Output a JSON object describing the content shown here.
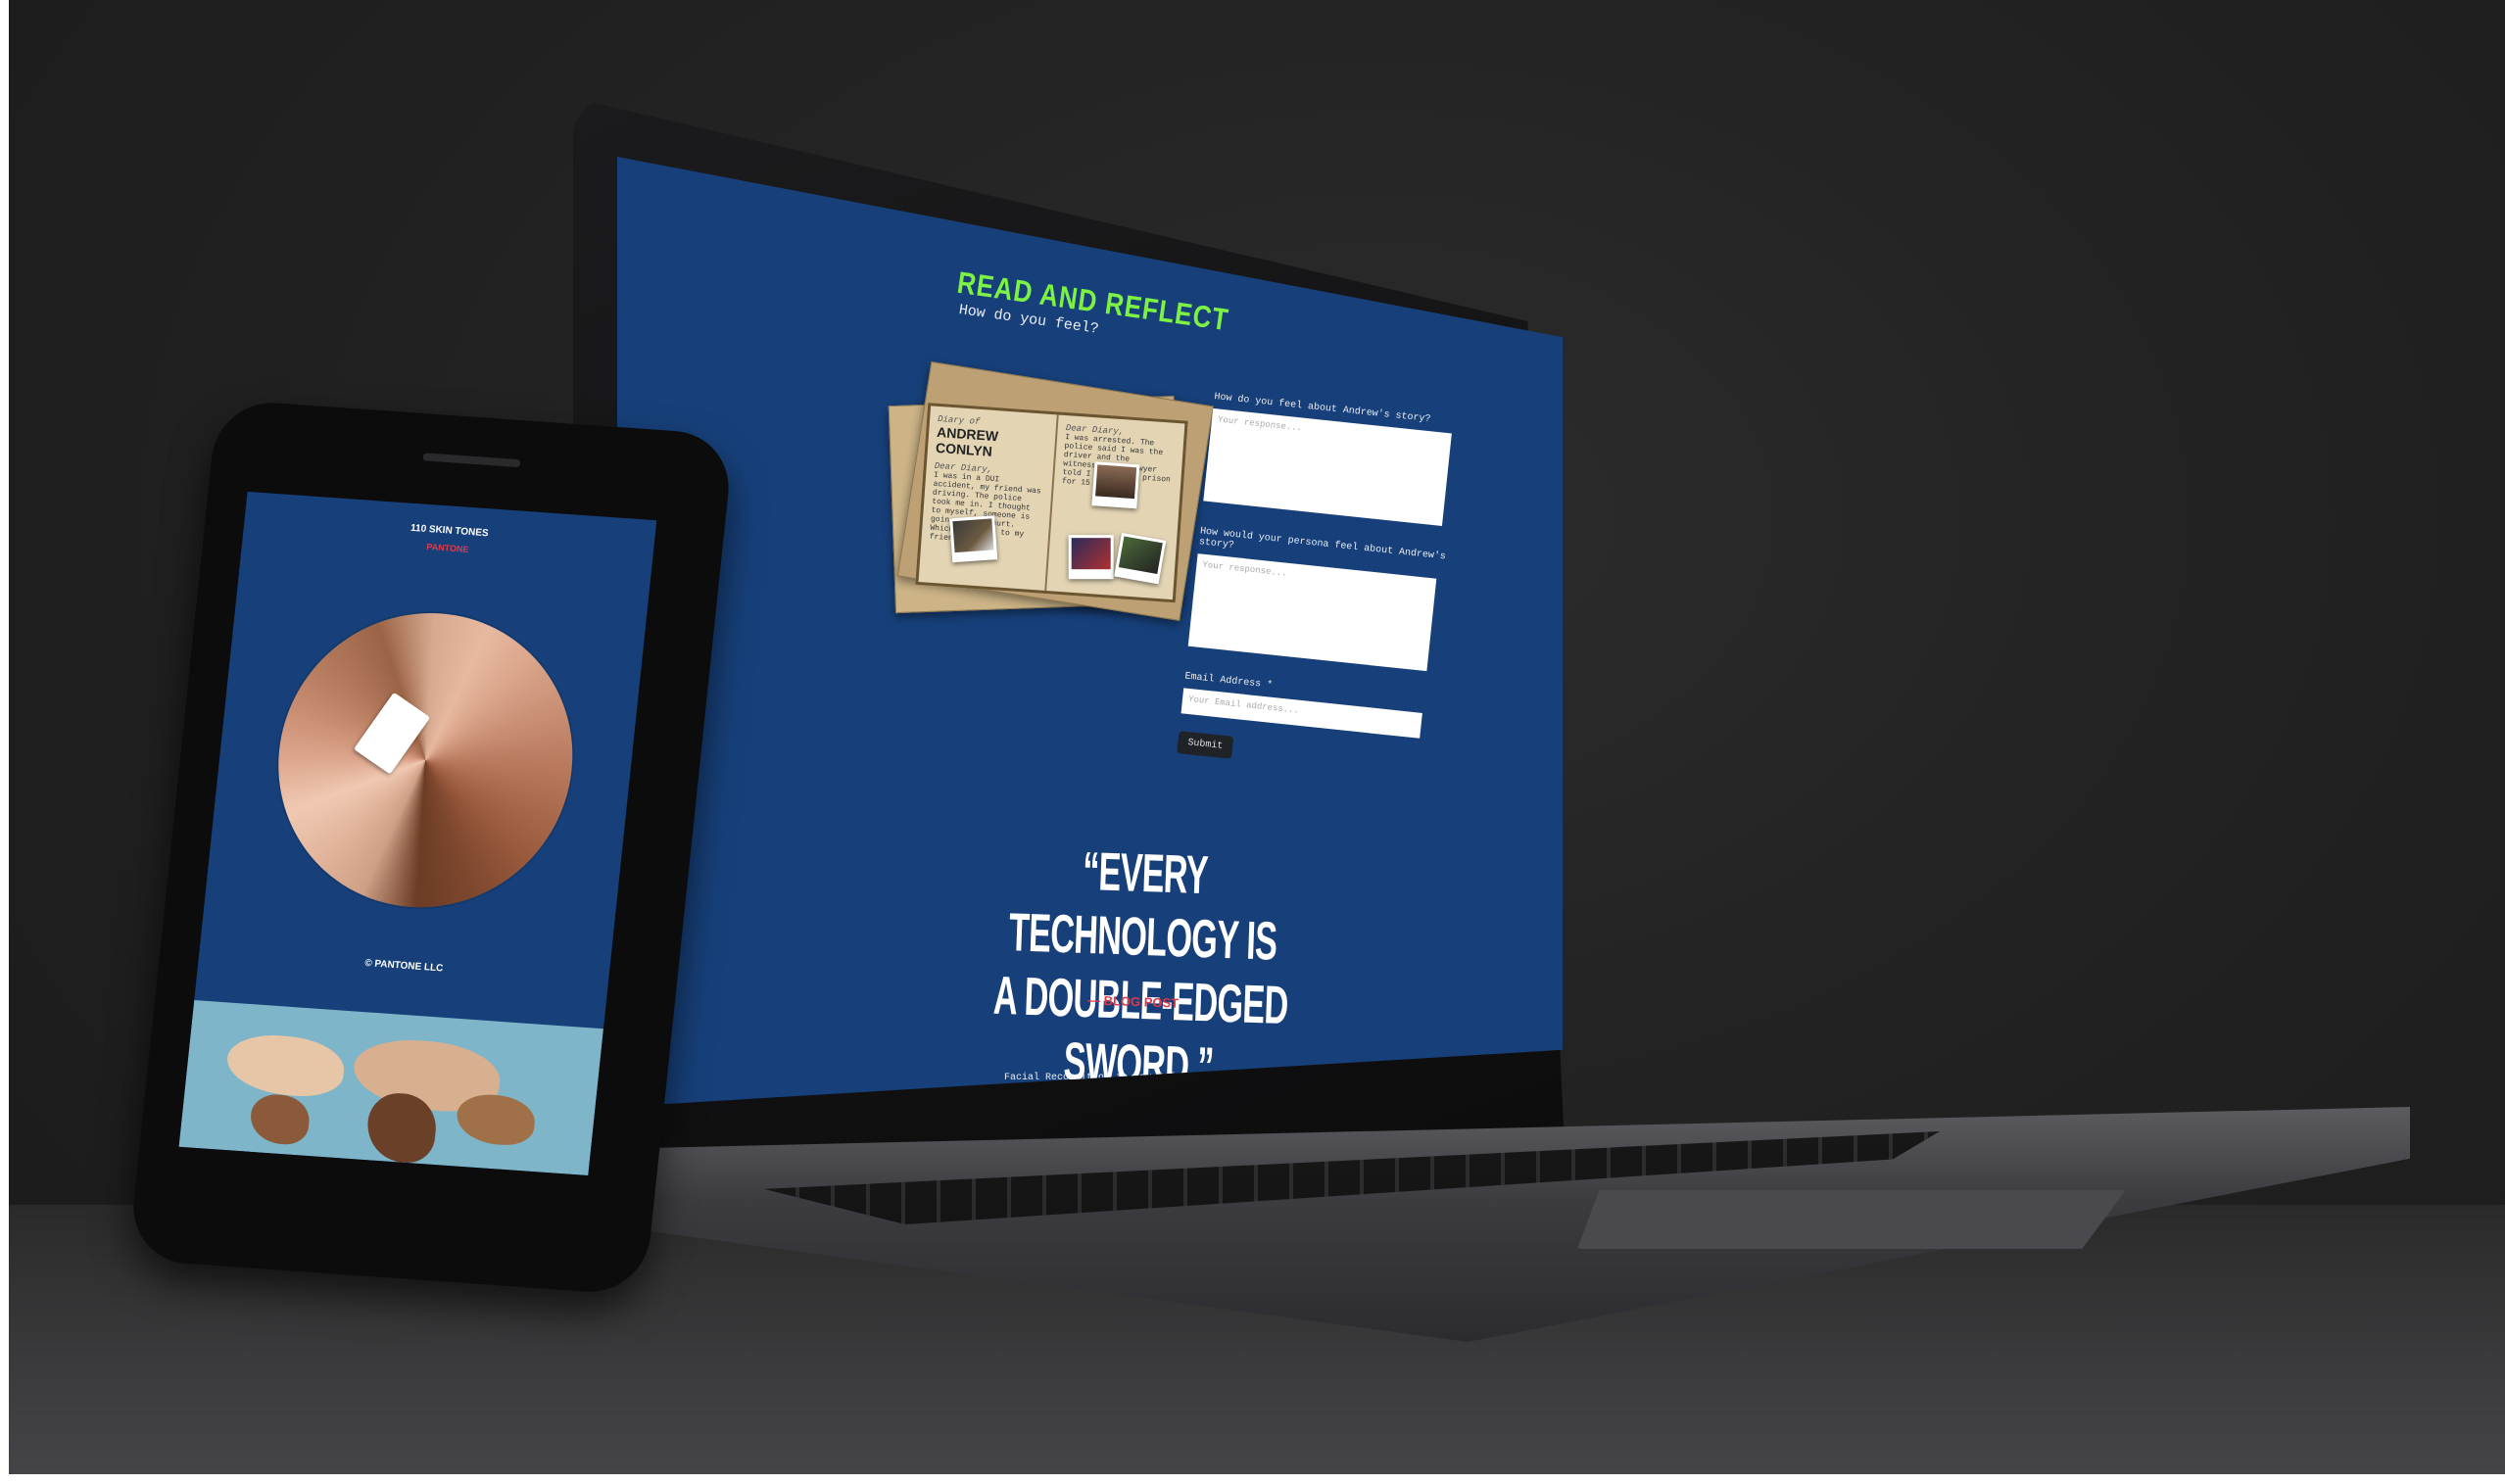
{
  "laptop": {
    "heading": "READ AND REFLECT",
    "subheading": "How do you feel?",
    "diary": {
      "label": "Diary of",
      "name": "ANDREW CONLYN",
      "entry_greeting": "Dear Diary,",
      "entry_text": "I was in a DUI accident, my friend was driving. The police took me in. I thought to myself, someone is going to get hurt. Which happened to my friend.",
      "right_greeting": "Dear Diary,",
      "right_text": "I was arrested. The police said I was the driver and the witnesses. My lawyer told I can be in prison for 15 years."
    },
    "form": {
      "q1_label": "How do you feel about Andrew's story?",
      "q1_placeholder": "Your response...",
      "q2_label": "How would your persona feel about Andrew's story?",
      "q2_placeholder": "Your response...",
      "email_label": "Email Address *",
      "email_placeholder": "Your Email address...",
      "submit_label": "Submit"
    },
    "quote_line1": "“EVERY TECHNOLOGY IS",
    "quote_line2": "A DOUBLE-EDGED SWORD.”",
    "quote_attribution": "— BLOG POST",
    "bottom_text": "Facial Recognition in Law Enforcement: The police use"
  },
  "phone": {
    "title": "110 SKIN TONES",
    "brand": "PANTONE",
    "copyright": "© PANTONE LLC"
  }
}
